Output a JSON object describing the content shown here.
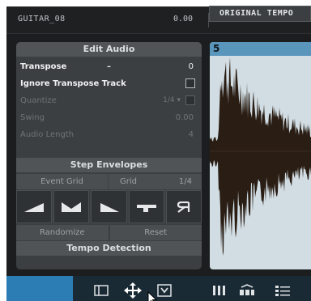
{
  "topbar": {
    "track_name": "GUITAR_08",
    "track_value": "0.00",
    "tempo_button": "ORIGINAL TEMPO"
  },
  "edit_audio": {
    "header": "Edit Audio",
    "transpose": {
      "label": "Transpose",
      "dash": "–",
      "value": "0"
    },
    "ignore_transpose": {
      "label": "Ignore Transpose Track"
    },
    "quantize": {
      "label": "Quantize",
      "value": "1/4"
    },
    "swing": {
      "label": "Swing",
      "value": "0.00"
    },
    "audio_length": {
      "label": "Audio Length",
      "value": "4"
    }
  },
  "step_envelopes": {
    "header": "Step Envelopes",
    "event_grid": "Event Grid",
    "grid_label": "Grid",
    "grid_value": "1/4",
    "shapes": [
      "ramp-up-icon",
      "valley-icon",
      "ramp-down-icon",
      "step-pattern-icon",
      "reverse-r-icon"
    ],
    "randomize": "Randomize",
    "reset": "Reset"
  },
  "tempo_detection": {
    "header": "Tempo Detection"
  },
  "waveform": {
    "marker": "5"
  },
  "colors": {
    "accent": "#2b7db4",
    "panel": "#3c3f41",
    "wave_bg": "#d1dde3",
    "ruler": "#5a96bb"
  }
}
